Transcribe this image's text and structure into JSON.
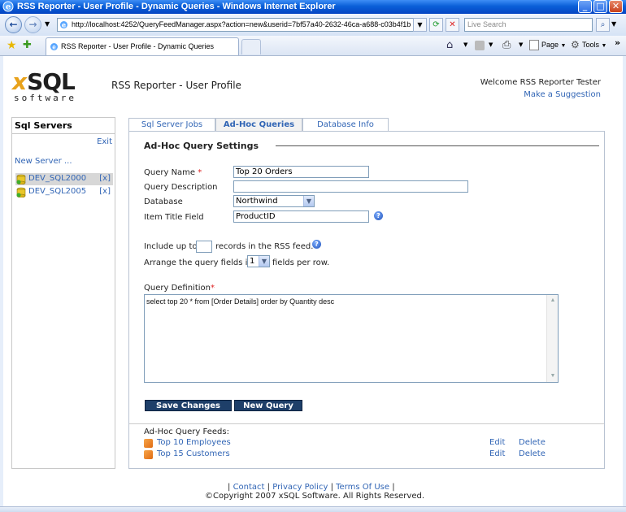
{
  "window": {
    "title": "RSS Reporter - User Profile - Dynamic Queries - Windows Internet Explorer"
  },
  "browser": {
    "url": "http://localhost:4252/QueryFeedManager.aspx?action=new&userid=7bf57a40-2632-46ca-a688-c03b4f1b",
    "search_placeholder": "Live Search",
    "tab_title": "RSS Reporter - User Profile - Dynamic Queries",
    "page_menu": "Page",
    "tools_menu": "Tools"
  },
  "header": {
    "logo_x": "x",
    "logo_sql": "SQL",
    "logo_software": "software",
    "title": "RSS Reporter - User Profile",
    "welcome": "Welcome RSS Reporter Tester",
    "suggestion_link": "Make a Suggestion"
  },
  "sidebar": {
    "title": "Sql Servers",
    "exit": "Exit",
    "new_server": "New Server ...",
    "servers": [
      {
        "name": "DEV_SQL2000",
        "remove": "[x]",
        "selected": true
      },
      {
        "name": "DEV_SQL2005",
        "remove": "[x]",
        "selected": false
      }
    ]
  },
  "tabs": [
    {
      "label": "Sql Server Jobs",
      "active": false
    },
    {
      "label": "Ad-Hoc Queries",
      "active": true
    },
    {
      "label": "Database Info",
      "active": false
    }
  ],
  "form": {
    "section_title": "Ad-Hoc Query Settings",
    "query_name_label": "Query Name",
    "query_name_value": "Top 20 Orders",
    "query_desc_label": "Query Description",
    "query_desc_value": "",
    "database_label": "Database",
    "database_value": "Northwind",
    "item_title_label": "Item Title Field",
    "item_title_value": "ProductID",
    "include_prefix": "Include up to",
    "include_value": "",
    "include_suffix": "records in the RSS feed.",
    "arrange_prefix": "Arrange the query fields in",
    "arrange_value": "1",
    "arrange_suffix": "fields per row.",
    "definition_label": "Query Definition",
    "definition_value": "select top 20 * from [Order Details] order by Quantity desc",
    "required_mark": "*",
    "help_glyph": "?",
    "save_button": "Save Changes",
    "new_query_button": "New Query"
  },
  "feeds": {
    "header": "Ad-Hoc Query Feeds:",
    "items": [
      {
        "name": "Top 10 Employees",
        "edit": "Edit",
        "delete": "Delete"
      },
      {
        "name": "Top 15 Customers",
        "edit": "Edit",
        "delete": "Delete"
      }
    ]
  },
  "footer": {
    "sep": "|",
    "contact": "Contact",
    "privacy": "Privacy Policy",
    "terms": "Terms Of Use",
    "copyright": "©Copyright 2007 xSQL Software. All Rights Reserved."
  },
  "colors": {
    "link": "#3165b5",
    "button_bg": "#1e3f69",
    "titlebar": "#0a5fd8",
    "logo_accent": "#e8a21b"
  }
}
